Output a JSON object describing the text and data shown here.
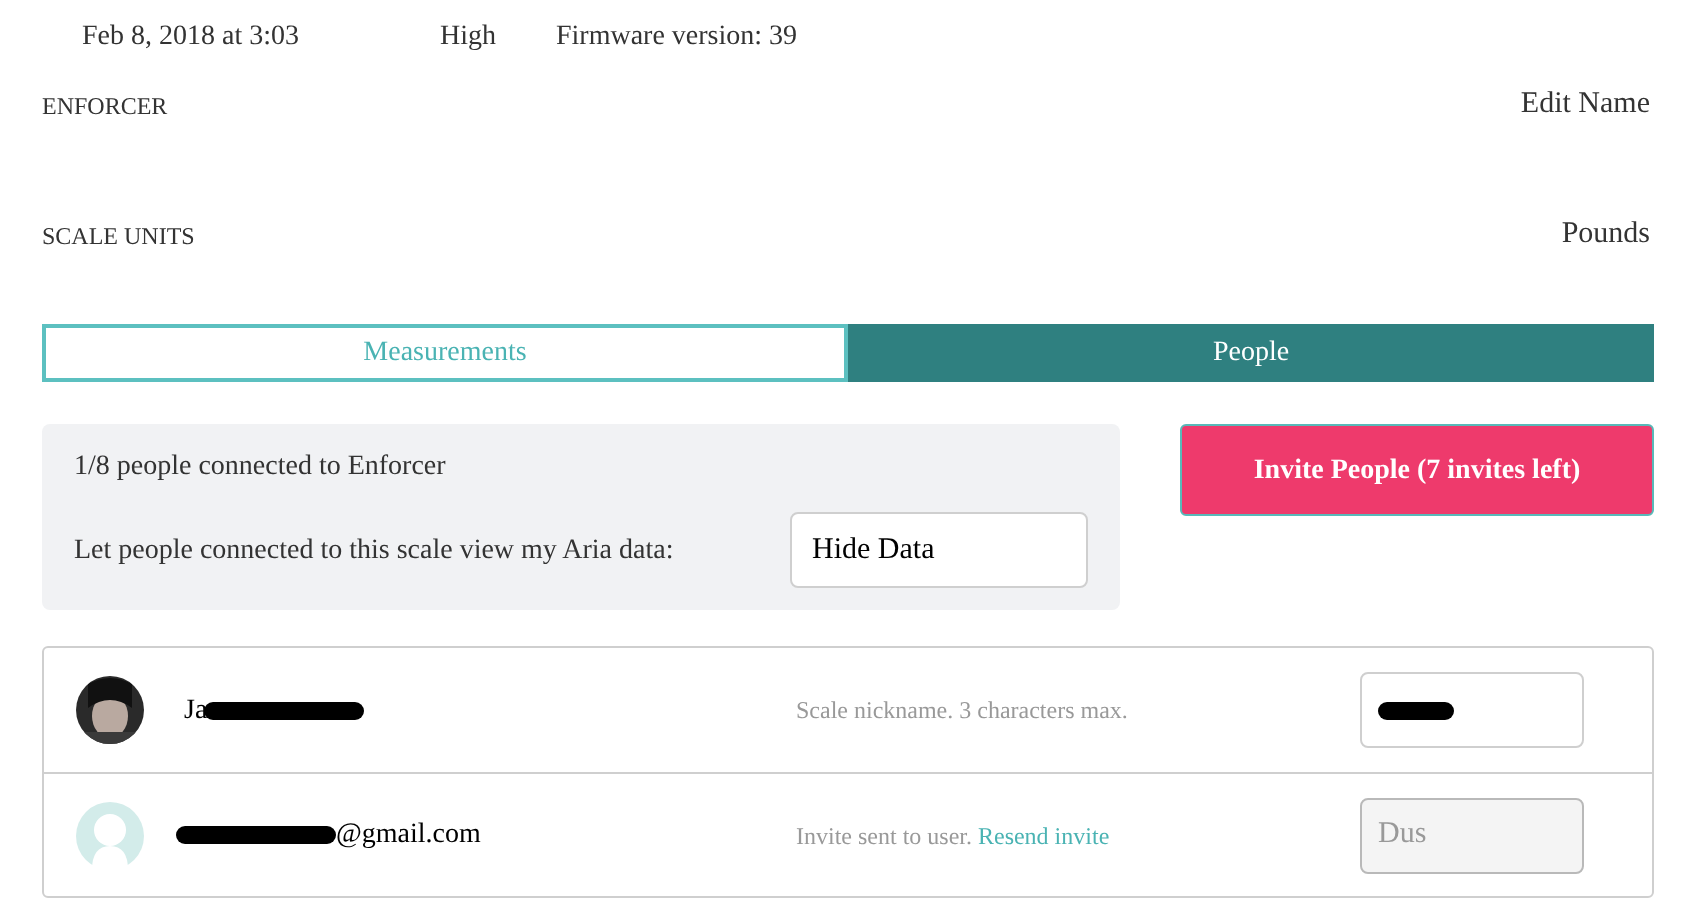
{
  "header": {
    "date": "Feb 8, 2018 at 3:03",
    "level": "High",
    "firmware": "Firmware version: 39"
  },
  "settings": [
    {
      "label": "ENFORCER",
      "action": "Edit Name"
    },
    {
      "label": "SCALE UNITS",
      "action": "Pounds"
    }
  ],
  "tabs": [
    {
      "label": "Measurements",
      "selected": false
    },
    {
      "label": "People",
      "selected": true
    }
  ],
  "sharing": {
    "status": "1/8 people connected to Enforcer",
    "prompt": "Let people connected to this scale view my Aria data:",
    "value": "Hide Data"
  },
  "invite_button": "Invite People (7 invites left)",
  "people": [
    {
      "kind": "member",
      "name": "Ja",
      "redacted": true,
      "note": "Scale nickname. 3 characters max.",
      "nickname_redacted": true,
      "disabled": false
    },
    {
      "kind": "invited",
      "name": "@gmail.com",
      "redacted": true,
      "note": "Invite sent to user.",
      "link": "Resend invite",
      "nickname": "Dus",
      "nickname_redacted": false,
      "disabled": true
    }
  ]
}
